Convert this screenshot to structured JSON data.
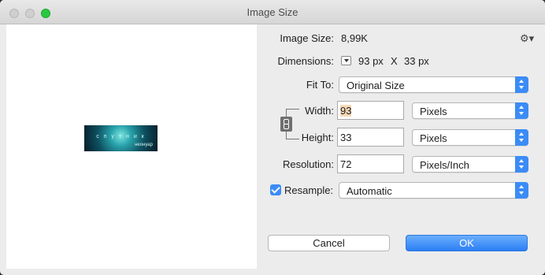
{
  "window": {
    "title": "Image Size"
  },
  "preview": {
    "line1": "с п у т н и к",
    "line2": "неонуар"
  },
  "image_size": {
    "label": "Image Size:",
    "value": "8,99K"
  },
  "dimensions": {
    "label": "Dimensions:",
    "width_value": "93 px",
    "separator": "X",
    "height_value": "33 px"
  },
  "fit_to": {
    "label": "Fit To:",
    "selected": "Original Size"
  },
  "width": {
    "label": "Width:",
    "value": "93",
    "unit": "Pixels"
  },
  "height": {
    "label": "Height:",
    "value": "33",
    "unit": "Pixels"
  },
  "resolution": {
    "label": "Resolution:",
    "value": "72",
    "unit": "Pixels/Inch"
  },
  "resample": {
    "label": "Resample:",
    "checked": true,
    "selected": "Automatic"
  },
  "buttons": {
    "cancel": "Cancel",
    "ok": "OK"
  },
  "colors": {
    "accent": "#3b8cf6",
    "zoom_green": "#2ac840"
  },
  "icons": {
    "gear": "gear-icon",
    "link": "link-icon",
    "disclosure": "disclosure-triangle-icon"
  }
}
